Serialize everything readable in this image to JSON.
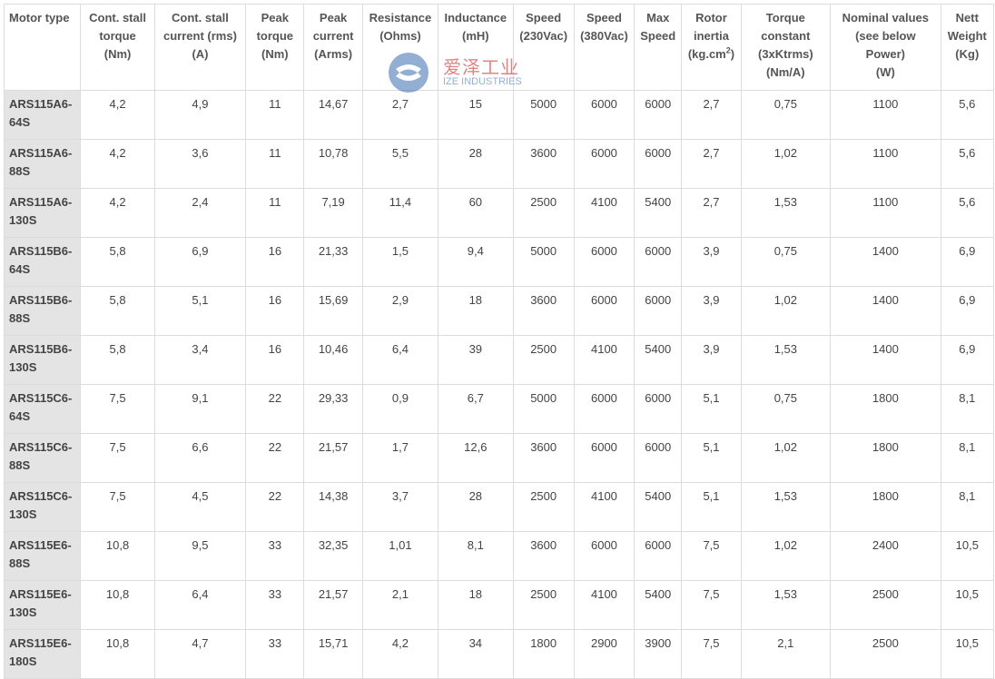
{
  "headers": [
    [
      "Motor type"
    ],
    [
      "Cont. stall",
      "torque",
      "(Nm)"
    ],
    [
      "Cont. stall",
      "current (rms)",
      "(A)"
    ],
    [
      "Peak",
      "torque",
      "(Nm)"
    ],
    [
      "Peak",
      "current",
      "(Arms)"
    ],
    [
      "Resistance",
      "(Ohms)"
    ],
    [
      "Inductance",
      "(mH)"
    ],
    [
      "Speed",
      "(230Vac)"
    ],
    [
      "Speed",
      "(380Vac)"
    ],
    [
      "Max",
      "Speed"
    ],
    [
      "Rotor",
      "inertia",
      "(kg.cm",
      ")"
    ],
    [
      "Torque",
      "constant",
      "(3xKtrms)",
      "(Nm/A)"
    ],
    [
      "Nominal values",
      "(see below",
      "Power)",
      "(W)"
    ],
    [
      "Nett",
      "Weight",
      "(Kg)"
    ]
  ],
  "inertia_exponent": "2",
  "watermark": {
    "chinese": "爱泽工业",
    "english": "IZE INDUSTRIES",
    "logo_color": "#3a6fb0"
  },
  "rows": [
    [
      "ARS115A6-64S",
      "4,2",
      "4,9",
      "11",
      "14,67",
      "2,7",
      "15",
      "5000",
      "6000",
      "6000",
      "2,7",
      "0,75",
      "1100",
      "5,6"
    ],
    [
      "ARS115A6-88S",
      "4,2",
      "3,6",
      "11",
      "10,78",
      "5,5",
      "28",
      "3600",
      "6000",
      "6000",
      "2,7",
      "1,02",
      "1100",
      "5,6"
    ],
    [
      "ARS115A6-130S",
      "4,2",
      "2,4",
      "11",
      "7,19",
      "11,4",
      "60",
      "2500",
      "4100",
      "5400",
      "2,7",
      "1,53",
      "1100",
      "5,6"
    ],
    [
      "ARS115B6-64S",
      "5,8",
      "6,9",
      "16",
      "21,33",
      "1,5",
      "9,4",
      "5000",
      "6000",
      "6000",
      "3,9",
      "0,75",
      "1400",
      "6,9"
    ],
    [
      "ARS115B6-88S",
      "5,8",
      "5,1",
      "16",
      "15,69",
      "2,9",
      "18",
      "3600",
      "6000",
      "6000",
      "3,9",
      "1,02",
      "1400",
      "6,9"
    ],
    [
      "ARS115B6-130S",
      "5,8",
      "3,4",
      "16",
      "10,46",
      "6,4",
      "39",
      "2500",
      "4100",
      "5400",
      "3,9",
      "1,53",
      "1400",
      "6,9"
    ],
    [
      "ARS115C6-64S",
      "7,5",
      "9,1",
      "22",
      "29,33",
      "0,9",
      "6,7",
      "5000",
      "6000",
      "6000",
      "5,1",
      "0,75",
      "1800",
      "8,1"
    ],
    [
      "ARS115C6-88S",
      "7,5",
      "6,6",
      "22",
      "21,57",
      "1,7",
      "12,6",
      "3600",
      "6000",
      "6000",
      "5,1",
      "1,02",
      "1800",
      "8,1"
    ],
    [
      "ARS115C6-130S",
      "7,5",
      "4,5",
      "22",
      "14,38",
      "3,7",
      "28",
      "2500",
      "4100",
      "5400",
      "5,1",
      "1,53",
      "1800",
      "8,1"
    ],
    [
      "ARS115E6-88S",
      "10,8",
      "9,5",
      "33",
      "32,35",
      "1,01",
      "8,1",
      "3600",
      "6000",
      "6000",
      "7,5",
      "1,02",
      "2400",
      "10,5"
    ],
    [
      "ARS115E6-130S",
      "10,8",
      "6,4",
      "33",
      "21,57",
      "2,1",
      "18",
      "2500",
      "4100",
      "5400",
      "7,5",
      "1,53",
      "2500",
      "10,5"
    ],
    [
      "ARS115E6-180S",
      "10,8",
      "4,7",
      "33",
      "15,71",
      "4,2",
      "34",
      "1800",
      "2900",
      "3900",
      "7,5",
      "2,1",
      "2500",
      "10,5"
    ]
  ]
}
